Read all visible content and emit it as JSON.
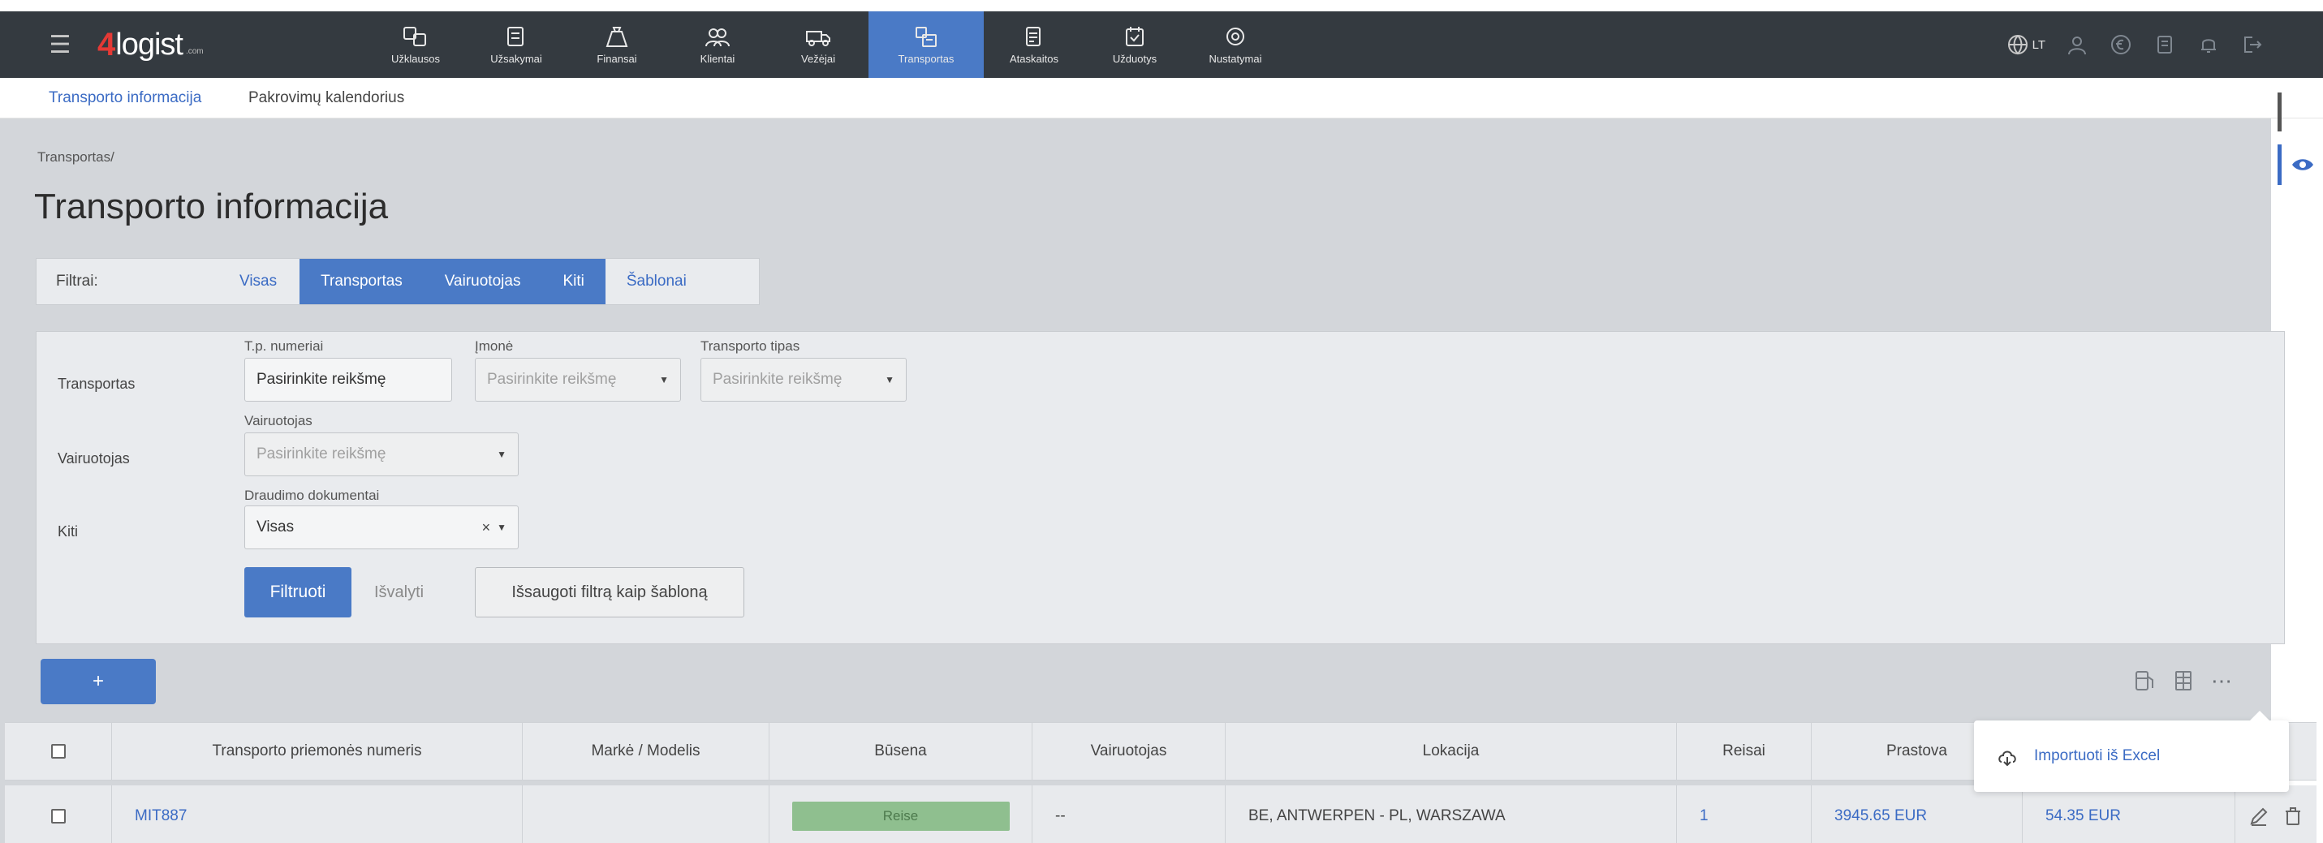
{
  "app": {
    "logo_four": "4",
    "logo_word": "logist",
    "logo_tld": ".com"
  },
  "nav": {
    "items": [
      {
        "label": "Užklausos",
        "icon": "inquiries-icon"
      },
      {
        "label": "Užsakymai",
        "icon": "orders-icon"
      },
      {
        "label": "Finansai",
        "icon": "finance-icon"
      },
      {
        "label": "Klientai",
        "icon": "clients-icon"
      },
      {
        "label": "Vežėjai",
        "icon": "carriers-icon"
      },
      {
        "label": "Transportas",
        "icon": "transport-icon",
        "active": true
      },
      {
        "label": "Ataskaitos",
        "icon": "reports-icon"
      },
      {
        "label": "Užduotys",
        "icon": "tasks-icon"
      },
      {
        "label": "Nustatymai",
        "icon": "settings-icon"
      }
    ],
    "language": "LT"
  },
  "subnav": {
    "item1": "Transporto informacija",
    "item2": "Pakrovimų kalendorius"
  },
  "breadcrumb": "Transportas/",
  "page_title": "Transporto informacija",
  "filter_tabs": {
    "label": "Filtrai:",
    "tabs": [
      "Visas",
      "Transportas",
      "Vairuotojas",
      "Kiti",
      "Šablonai"
    ]
  },
  "filters": {
    "transport": {
      "row_label": "Transportas",
      "plate_label": "T.p. numeriai",
      "plate_placeholder": "Pasirinkite reikšmę",
      "company_label": "Įmonė",
      "company_placeholder": "Pasirinkite reikšmę",
      "type_label": "Transporto tipas",
      "type_placeholder": "Pasirinkite reikšmę"
    },
    "driver": {
      "row_label": "Vairuotojas",
      "driver_label": "Vairuotojas",
      "driver_placeholder": "Pasirinkite reikšmę"
    },
    "other": {
      "row_label": "Kiti",
      "insurance_label": "Draudimo dokumentai",
      "insurance_value": "Visas"
    },
    "buttons": {
      "filter": "Filtruoti",
      "clear": "Išvalyti",
      "save_template": "Išsaugoti filtrą kaip šabloną"
    }
  },
  "add_button": "+",
  "table": {
    "headers": [
      "Transporto priemonės numeris",
      "Markė / Modelis",
      "Būsena",
      "Vairuotojas",
      "Lokacija",
      "Reisai",
      "Prastova",
      "",
      ""
    ],
    "rows": [
      {
        "plate": "MIT887",
        "model": "",
        "status": "Reise",
        "driver": "--",
        "location": "BE, ANTWERPEN - PL, WARSZAWA",
        "trips": "1",
        "downtime": "3945.65 EUR",
        "extra": "54.35 EUR"
      }
    ]
  },
  "popover": {
    "label": "Importuoti iš Excel"
  }
}
